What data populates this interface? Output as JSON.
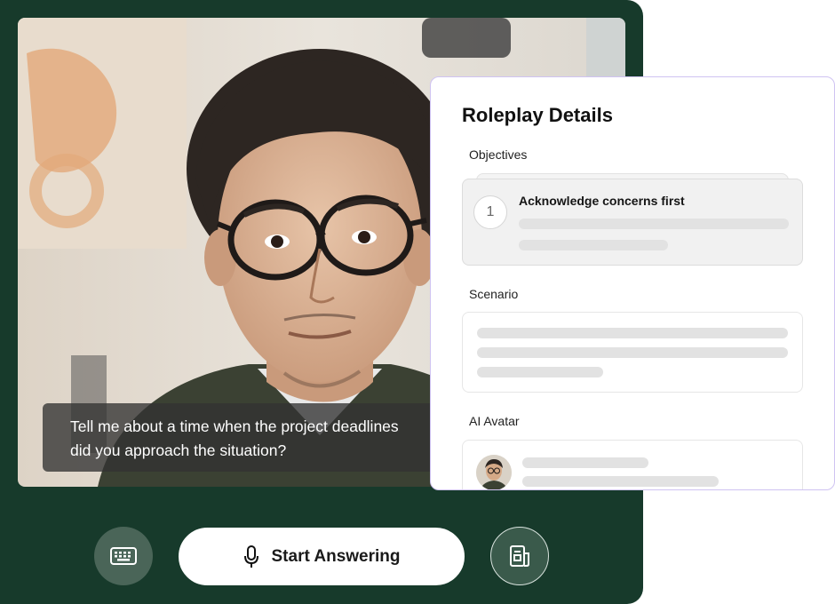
{
  "caption": {
    "text": "Tell me about a time when the project deadlines\ndid you approach the situation?"
  },
  "controls": {
    "start_label": "Start Answering"
  },
  "panel": {
    "title": "Roleplay Details",
    "objectives_label": "Objectives",
    "objective": {
      "number": "1",
      "text": "Acknowledge concerns first"
    },
    "scenario_label": "Scenario",
    "avatar_label": "AI Avatar"
  },
  "icons": {
    "keyboard": "keyboard-icon",
    "microphone": "microphone-icon",
    "notes": "document-icon"
  },
  "colors": {
    "frame": "#173a2b",
    "panel_border": "#cfc3f2",
    "caption_bg": "#323232"
  }
}
